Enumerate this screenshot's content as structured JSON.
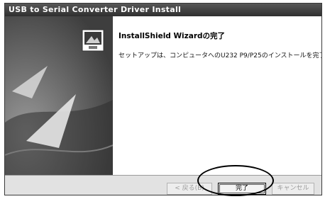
{
  "window": {
    "title": "USB to Serial Converter Driver Install"
  },
  "main": {
    "heading": "InstallShield Wizardの完了",
    "message": "セットアップは、コンピュータへのU232 P9/P25のインストールを完了しました。"
  },
  "buttons": {
    "back": "< 戻る(B)",
    "finish": "完了",
    "cancel": "キャンセル"
  },
  "colors": {
    "titlebar": "#3f3f3f",
    "sidepanel": "#5a5a5a",
    "highlight": "#000000"
  },
  "icons": {
    "setup": "installer-monitor-icon"
  }
}
